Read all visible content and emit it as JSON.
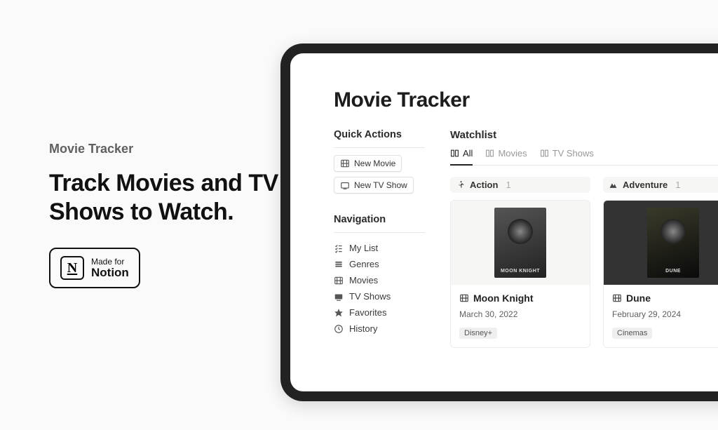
{
  "promo": {
    "subtitle": "Movie Tracker",
    "title": "Track Movies and TV Shows to Watch.",
    "badge_line1": "Made for",
    "badge_line2": "Notion",
    "badge_glyph": "N"
  },
  "page": {
    "title": "Movie Tracker"
  },
  "quick_actions": {
    "heading": "Quick Actions",
    "new_movie_label": "New Movie",
    "new_tv_show_label": "New TV Show"
  },
  "navigation": {
    "heading": "Navigation",
    "items": [
      {
        "label": "My List"
      },
      {
        "label": "Genres"
      },
      {
        "label": "Movies"
      },
      {
        "label": "TV Shows"
      },
      {
        "label": "Favorites"
      },
      {
        "label": "History"
      }
    ]
  },
  "watchlist": {
    "heading": "Watchlist",
    "tabs": [
      {
        "label": "All",
        "active": true
      },
      {
        "label": "Movies",
        "active": false
      },
      {
        "label": "TV Shows",
        "active": false
      }
    ],
    "groups": [
      {
        "name": "Action",
        "count": "1",
        "icon": "run-icon",
        "card": {
          "title": "Moon Knight",
          "date": "March 30, 2022",
          "tag": "Disney+",
          "poster_label": "MOON KNIGHT"
        }
      },
      {
        "name": "Adventure",
        "count": "1",
        "icon": "mountain-icon",
        "card": {
          "title": "Dune",
          "date": "February 29, 2024",
          "tag": "Cinemas",
          "poster_label": "DUNE"
        }
      }
    ]
  }
}
